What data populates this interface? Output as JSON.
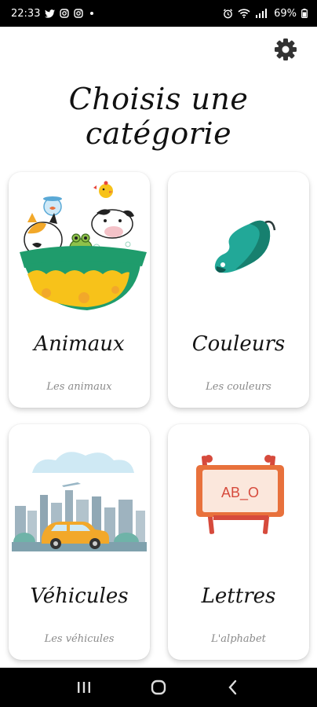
{
  "status_bar": {
    "time": "22:33",
    "battery": "69%",
    "icons": [
      "twitter-icon",
      "instagram-icon",
      "instagram-icon",
      "alarm-icon",
      "wifi-icon",
      "signal-icon",
      "battery-icon"
    ]
  },
  "header": {
    "settings_icon": "gear-icon",
    "title": "Choisis une catégorie"
  },
  "categories": [
    {
      "id": "animaux",
      "title": "Animaux",
      "subtitle": "Les animaux",
      "icon": "animals-bath-illustration"
    },
    {
      "id": "couleurs",
      "title": "Couleurs",
      "subtitle": "Les couleurs",
      "icon": "paint-palette-illustration"
    },
    {
      "id": "vehicules",
      "title": "Véhicules",
      "subtitle": "Les véhicules",
      "icon": "city-car-illustration"
    },
    {
      "id": "lettres",
      "title": "Lettres",
      "subtitle": "L'alphabet",
      "icon": "easel-board-illustration"
    }
  ],
  "easel_text": "AB_O",
  "navigation": {
    "buttons": [
      "recent-apps-icon",
      "home-icon",
      "back-icon"
    ]
  },
  "colors": {
    "background": "#ffffff",
    "bowl_green": "#1f9c6c",
    "bowl_yellow": "#f7c21a",
    "palette_teal": "#22a898",
    "car_yellow": "#f2a82a",
    "easel_orange": "#e8713c",
    "board_red": "#d64a3c"
  }
}
